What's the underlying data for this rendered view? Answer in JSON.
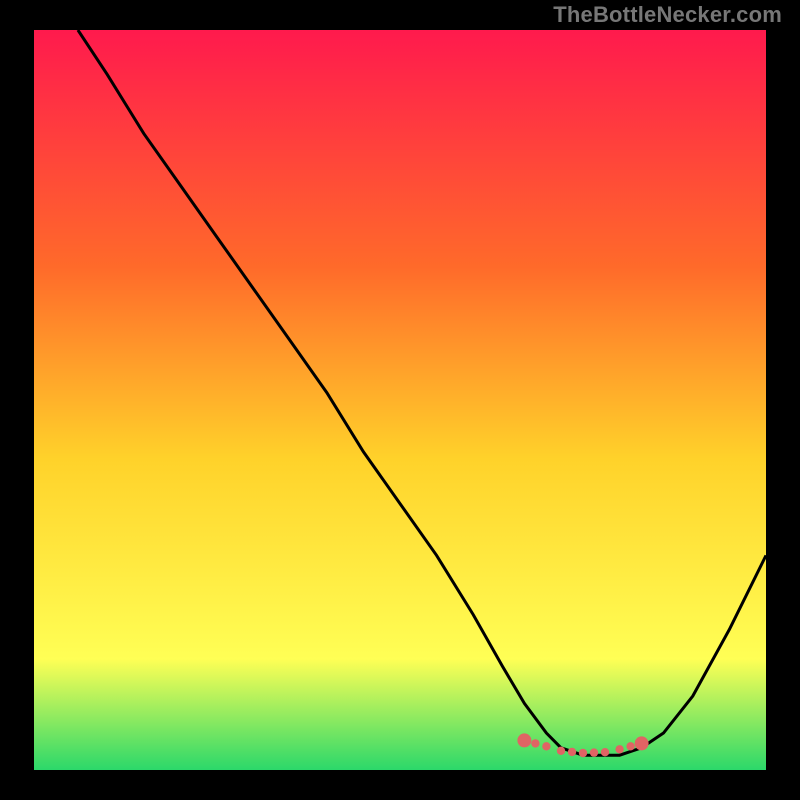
{
  "watermark": "TheBottleNecker.com",
  "colors": {
    "top_gradient": "#ff1a4d",
    "upper_mid": "#ff6a2a",
    "mid": "#ffd22a",
    "lower_mid": "#ffff55",
    "bottom_gradient": "#2bd86a",
    "curve_stroke": "#000000",
    "marker_fill": "#e06464",
    "frame_bg": "#000000"
  },
  "chart_data": {
    "type": "line",
    "title": "",
    "xlabel": "",
    "ylabel": "",
    "xlim": [
      0,
      100
    ],
    "ylim": [
      0,
      100
    ],
    "series": [
      {
        "name": "bottleneck-curve",
        "x": [
          6,
          10,
          15,
          20,
          25,
          30,
          35,
          40,
          45,
          50,
          55,
          60,
          64,
          67,
          70,
          72,
          75,
          78,
          80,
          83,
          86,
          90,
          95,
          100
        ],
        "y": [
          100,
          94,
          86,
          79,
          72,
          65,
          58,
          51,
          43,
          36,
          29,
          21,
          14,
          9,
          5,
          3,
          2,
          2,
          2,
          3,
          5,
          10,
          19,
          29
        ]
      }
    ],
    "highlight_segment": {
      "name": "optimal-zone",
      "x": [
        67,
        70,
        72,
        75,
        78,
        80,
        83
      ],
      "y": [
        4.0,
        3.2,
        2.6,
        2.3,
        2.4,
        2.8,
        3.6
      ]
    }
  }
}
